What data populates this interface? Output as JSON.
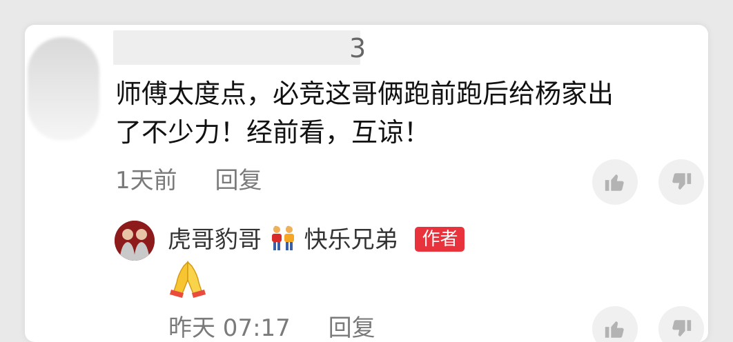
{
  "comment": {
    "username_partial": "3",
    "text_line1": "师傅太度点，必竞这哥俩跑前跑后给杨家出",
    "text_line2": "了不少力！经前看，互谅！",
    "time": "1天前",
    "reply_label": "回复"
  },
  "reply": {
    "author_name_part1": "虎哥豹哥",
    "author_name_part2": "快乐兄弟",
    "author_badge": "作者",
    "text_icon": "folded-hands-emoji",
    "time": "昨天 07:17",
    "reply_label": "回复"
  },
  "icons": {
    "like": "thumbs-up-icon",
    "dislike": "thumbs-down-icon",
    "couple": "two-men-emoji"
  },
  "colors": {
    "badge": "#e8323c",
    "meta_text": "#7a7a7a",
    "card_bg": "#ffffff",
    "page_bg": "#e9e9e9"
  }
}
